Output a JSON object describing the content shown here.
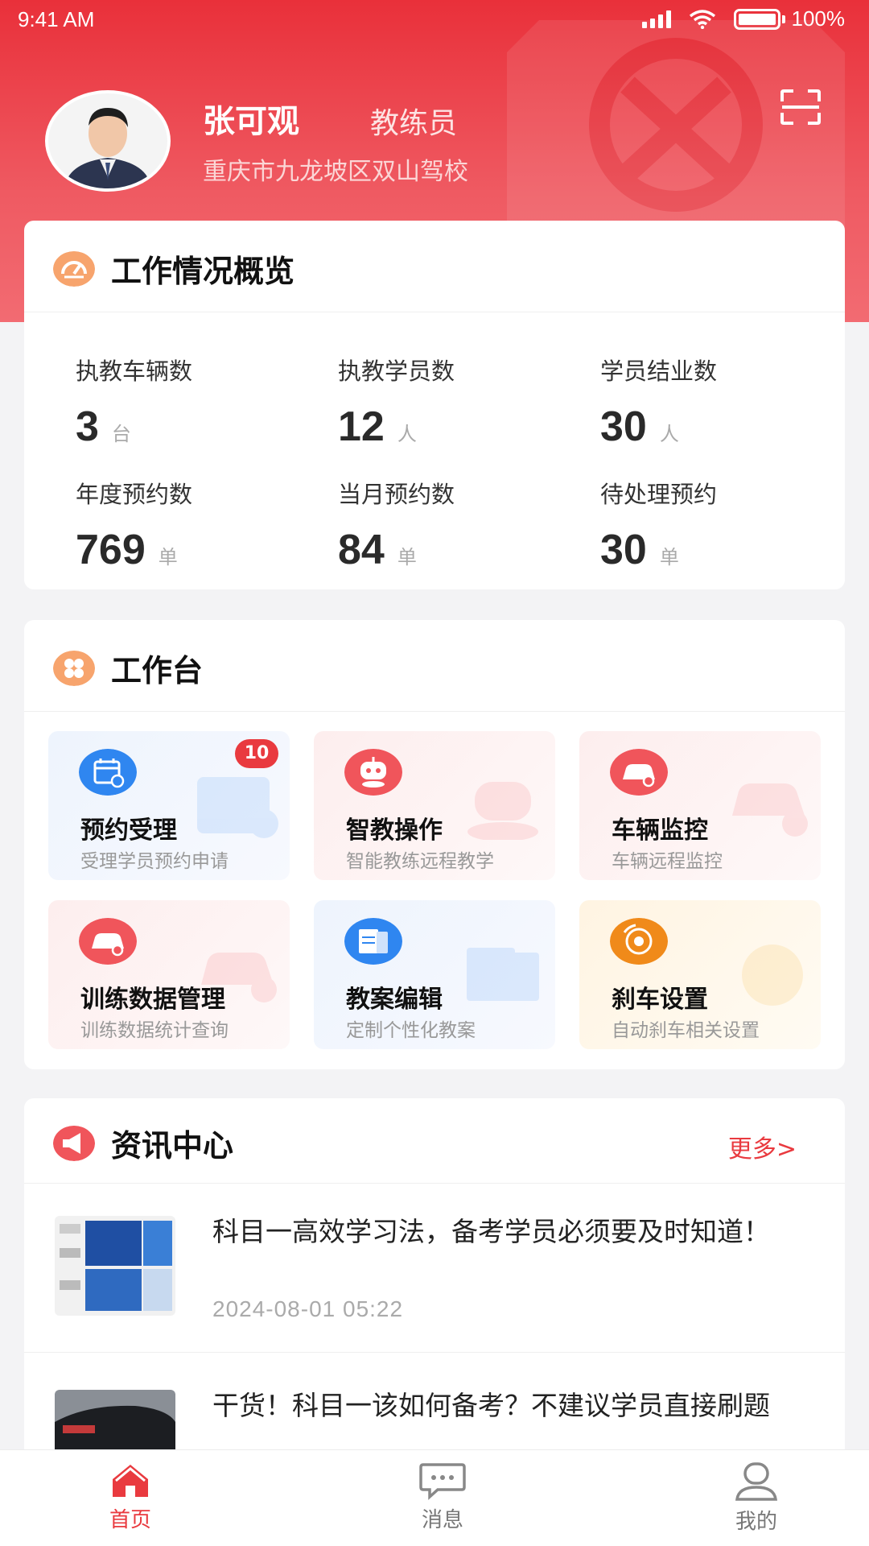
{
  "status": {
    "time": "9:41 AM",
    "battery": "100%"
  },
  "profile": {
    "name": "张可观",
    "role": "教练员",
    "school": "重庆市九龙坡区双山驾校"
  },
  "overview": {
    "title": "工作情况概览",
    "stats": [
      {
        "label": "执教车辆数",
        "value": "3",
        "unit": "台"
      },
      {
        "label": "执教学员数",
        "value": "12",
        "unit": "人"
      },
      {
        "label": "学员结业数",
        "value": "30",
        "unit": "人"
      },
      {
        "label": "年度预约数",
        "value": "769",
        "unit": "单"
      },
      {
        "label": "当月预约数",
        "value": "84",
        "unit": "单"
      },
      {
        "label": "待处理预约",
        "value": "30",
        "unit": "单"
      }
    ]
  },
  "workbench": {
    "title": "工作台",
    "tiles": [
      {
        "name": "预约受理",
        "desc": "受理学员预约申请",
        "badge": "10",
        "icon": "calendar-icon",
        "color": "#2f86f0"
      },
      {
        "name": "智教操作",
        "desc": "智能教练远程教学",
        "icon": "robot-icon",
        "color": "#f0555b"
      },
      {
        "name": "车辆监控",
        "desc": "车辆远程监控",
        "icon": "car-monitor-icon",
        "color": "#f0555b"
      },
      {
        "name": "训练数据管理",
        "desc": "训练数据统计查询",
        "icon": "car-data-icon",
        "color": "#f0555b"
      },
      {
        "name": "教案编辑",
        "desc": "定制个性化教案",
        "icon": "lesson-plan-icon",
        "color": "#2f86f0"
      },
      {
        "name": "刹车设置",
        "desc": "自动刹车相关设置",
        "icon": "brake-icon",
        "color": "#f08a1a"
      }
    ]
  },
  "news": {
    "title": "资讯中心",
    "more": "更多>",
    "items": [
      {
        "title": "科目一高效学习法，备考学员必须要及时知道！",
        "date": "2024-08-01 05:22"
      },
      {
        "title": "干货！科目一该如何备考？不建议学员直接刷题",
        "date": ""
      }
    ]
  },
  "tabs": [
    {
      "label": "首页",
      "icon": "home-icon",
      "active": true
    },
    {
      "label": "消息",
      "icon": "message-icon",
      "active": false
    },
    {
      "label": "我的",
      "icon": "user-icon",
      "active": false
    }
  ],
  "colors": {
    "accent": "#e93a3f",
    "hero": "#ea3640",
    "blue": "#2f86f0",
    "orange": "#f08a1a"
  }
}
